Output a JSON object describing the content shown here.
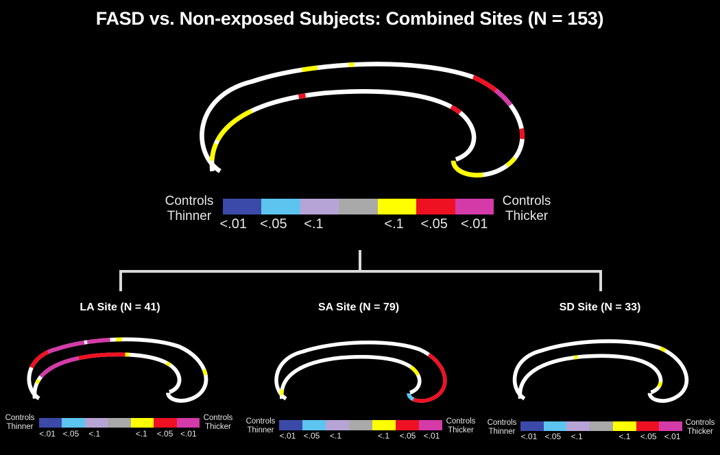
{
  "title": "FASD vs. Non-exposed Subjects: Combined Sites (N = 153)",
  "colors": {
    "thinner_p01": "#3b4aa8",
    "thinner_p05": "#5cc4ef",
    "thinner_p1": "#b7a4d6",
    "nonsig": "#a9a9a9",
    "thicker_p1": "#ffff00",
    "thicker_p05": "#ee1122",
    "thicker_p01": "#d43aa8",
    "outline": "#ffffff"
  },
  "legend": {
    "left_label_line1": "Controls",
    "left_label_line2": "Thinner",
    "right_label_line1": "Controls",
    "right_label_line2": "Thicker",
    "ticks": [
      "<.01",
      "<.05",
      "<.1",
      "",
      "<.1",
      "<.05",
      "<.01"
    ]
  },
  "sites": [
    {
      "label": "LA Site (N = 41)"
    },
    {
      "label": "SA Site (N = 79)"
    },
    {
      "label": "SD Site (N = 33)"
    }
  ]
}
